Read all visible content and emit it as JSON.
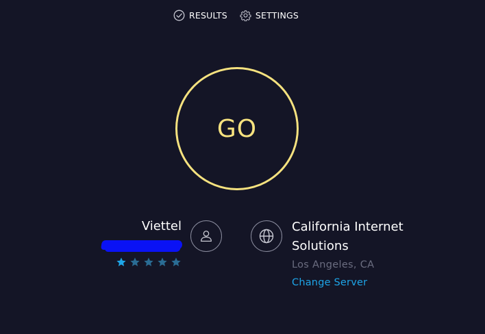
{
  "nav": {
    "results_label": "RESULTS",
    "results_icon": "check-circle-icon",
    "settings_label": "SETTINGS",
    "settings_icon": "gear-icon"
  },
  "go_button": {
    "label": "GO"
  },
  "isp": {
    "name": "Viettel",
    "icon": "user-icon",
    "rating": 1,
    "rating_max": 5
  },
  "server": {
    "icon": "globe-icon",
    "name": "California Internet Solutions",
    "location": "Los Angeles, CA",
    "change_label": "Change Server"
  },
  "colors": {
    "background": "#141526",
    "accent_go": "#f6e27f",
    "link": "#1ea5e8",
    "star_active": "#1ea5e8",
    "star_inactive": "#2a6c94",
    "muted": "#6b6d80"
  }
}
